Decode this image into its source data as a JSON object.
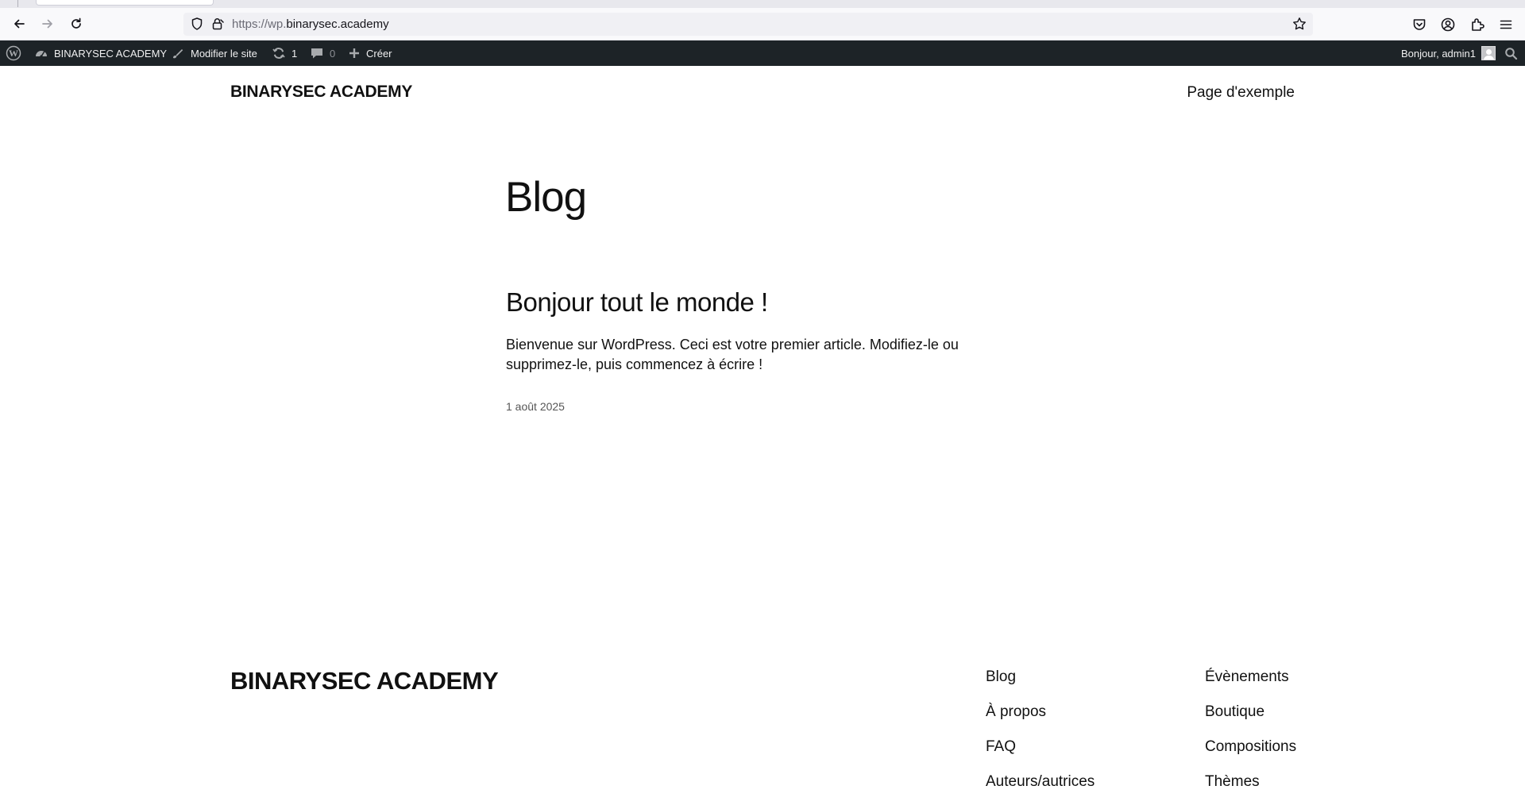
{
  "browser": {
    "url_scheme": "https://wp.",
    "url_host": "binarysec.academy"
  },
  "admin_bar": {
    "site_name": "BINARYSEC ACADEMY",
    "edit_site": "Modifier le site",
    "updates_count": "1",
    "comments_count": "0",
    "new_label": "Créer",
    "greeting": "Bonjour, admin1"
  },
  "header": {
    "site_title": "BINARYSEC ACADEMY",
    "nav_items": [
      "Page d'exemple"
    ]
  },
  "main": {
    "heading": "Blog",
    "posts": [
      {
        "title": "Bonjour tout le monde !",
        "excerpt": "Bienvenue sur WordPress. Ceci est votre premier article. Modifiez-le ou supprimez-le, puis commencez à écrire !",
        "date": "1 août 2025"
      }
    ]
  },
  "footer": {
    "site_title": "BINARYSEC ACADEMY",
    "nav_col1": [
      "Blog",
      "À propos",
      "FAQ",
      "Auteurs/autrices"
    ],
    "nav_col2": [
      "Évènements",
      "Boutique",
      "Compositions",
      "Thèmes"
    ]
  },
  "colors": {
    "admin_bar_bg": "#1d2327",
    "admin_bar_text": "#f0f0f1",
    "text": "#111111"
  }
}
